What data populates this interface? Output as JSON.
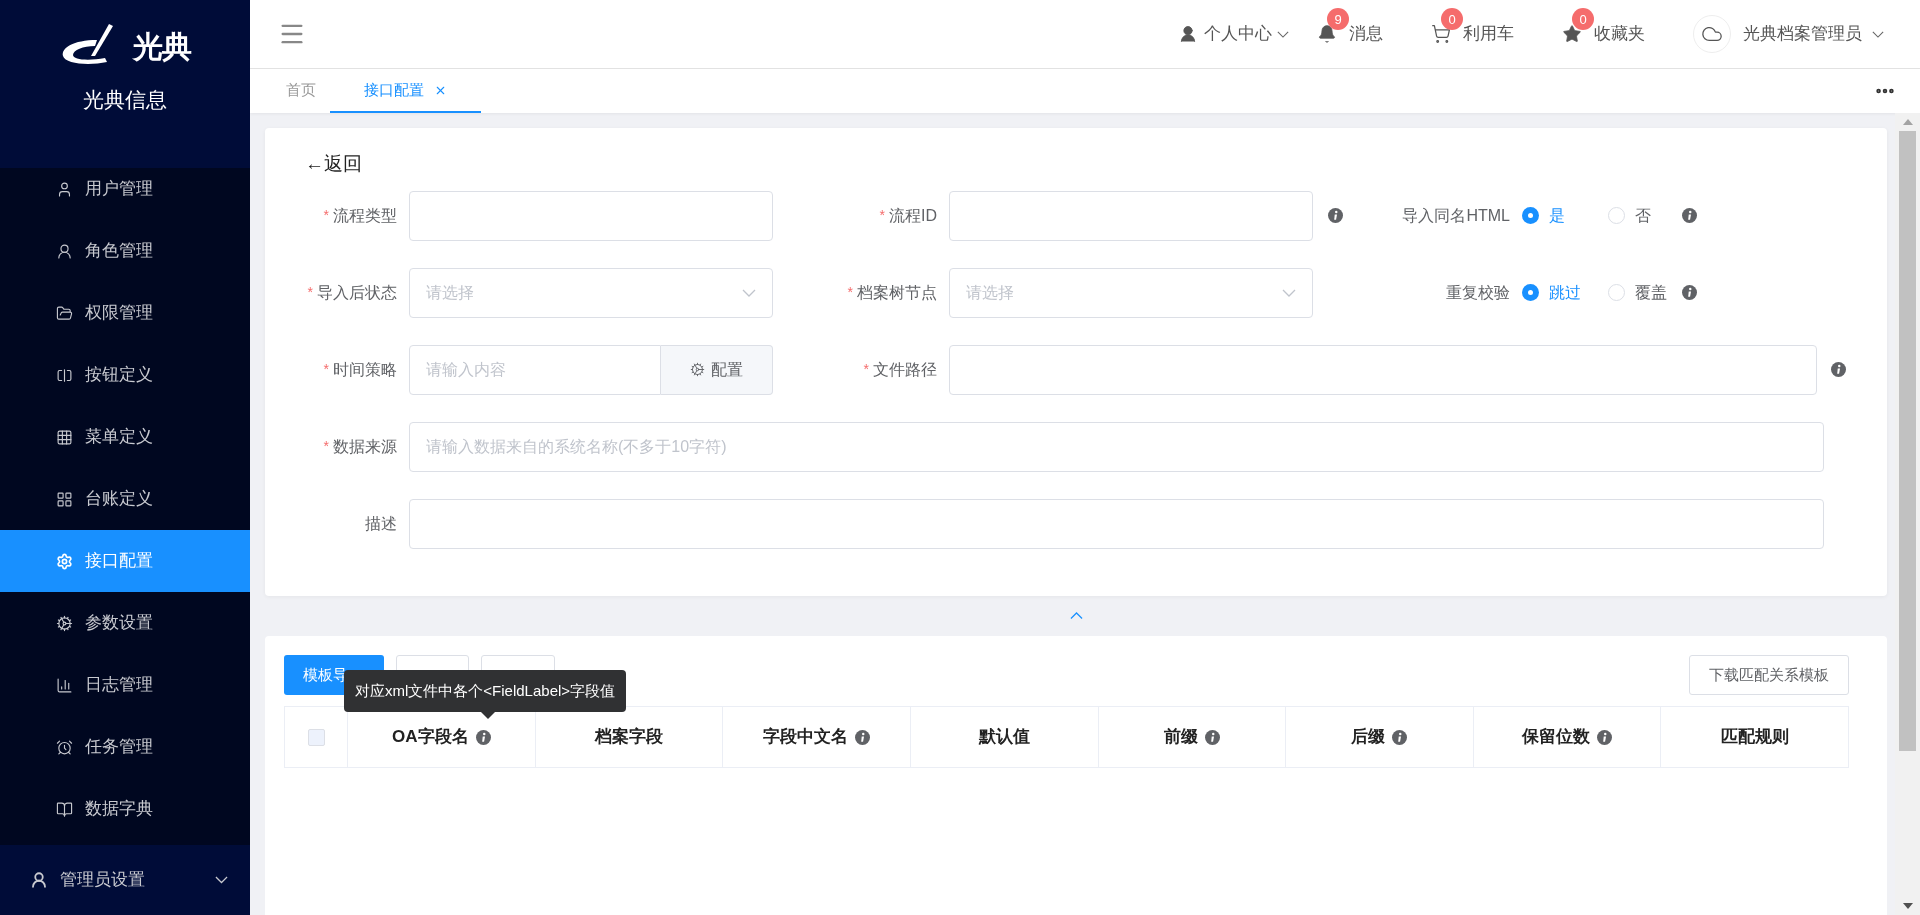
{
  "sidebar": {
    "brand": "光典",
    "title": "光典信息",
    "items": [
      {
        "label": "用户管理",
        "selected": false
      },
      {
        "label": "角色管理",
        "selected": false
      },
      {
        "label": "权限管理",
        "selected": false
      },
      {
        "label": "按钮定义",
        "selected": false
      },
      {
        "label": "菜单定义",
        "selected": false
      },
      {
        "label": "台账定义",
        "selected": false
      },
      {
        "label": "接口配置",
        "selected": true
      },
      {
        "label": "参数设置",
        "selected": false
      },
      {
        "label": "日志管理",
        "selected": false
      },
      {
        "label": "任务管理",
        "selected": false
      },
      {
        "label": "数据字典",
        "selected": false
      }
    ],
    "footer": {
      "label": "管理员设置",
      "expanded": false
    }
  },
  "header": {
    "items": [
      {
        "label": "个人中心",
        "dropdown": true
      },
      {
        "label": "消息",
        "badge": "9",
        "dropdown": false
      },
      {
        "label": "利用车",
        "badge": "0",
        "dropdown": false
      },
      {
        "label": "收藏夹",
        "badge": "0",
        "dropdown": false
      }
    ],
    "user": "光典档案管理员"
  },
  "tabs": [
    {
      "label": "首页",
      "selected": false,
      "closable": false
    },
    {
      "label": "接口配置",
      "selected": true,
      "closable": true
    }
  ],
  "back": "←返回",
  "form": {
    "rows": [
      [
        {
          "kind": "text",
          "mark": "*",
          "label": "流程类型"
        },
        {
          "kind": "text",
          "mark": "*",
          "label": "流程ID",
          "info": true
        },
        {
          "kind": "radio",
          "label": "导入同名HTML",
          "info": true,
          "options": [
            {
              "label": "是",
              "selected": true
            },
            {
              "label": "否",
              "selected": false
            }
          ]
        }
      ],
      [
        {
          "kind": "select",
          "mark": "*",
          "label": "导入后状态",
          "placeholder": "请选择"
        },
        {
          "kind": "select",
          "mark": "*",
          "label": "档案树节点",
          "placeholder": "请选择"
        },
        {
          "kind": "radio",
          "label": "重复校验",
          "info": true,
          "options": [
            {
              "label": "跳过",
              "selected": true
            },
            {
              "label": "覆盖",
              "selected": false
            }
          ]
        }
      ],
      [
        {
          "kind": "input_button",
          "mark": "*",
          "label": "时间策略",
          "placeholder": "请输入内容",
          "button": "配置"
        },
        {
          "kind": "wide",
          "mark": "*",
          "label": "文件路径",
          "info": true
        }
      ],
      [
        {
          "kind": "full",
          "mark": "*",
          "label": "数据来源",
          "placeholder": "请输入数据来自的系统名称(不多于10字符)"
        }
      ],
      [
        {
          "kind": "full",
          "label": "描述"
        }
      ]
    ]
  },
  "toolbar": {
    "buttons": [
      {
        "label": "模板导",
        "primary": true
      },
      {
        "primary": false
      },
      {
        "primary": false
      }
    ],
    "download": "下载匹配关系模板"
  },
  "tooltip": "对应xml文件中各个<FieldLabel>字段值",
  "table": {
    "select_all": {
      "checked": false
    },
    "columns": [
      {
        "label": "OA字段名",
        "info": true
      },
      {
        "label": "档案字段",
        "info": false
      },
      {
        "label": "字段中文名",
        "info": true
      },
      {
        "label": "默认值",
        "info": false
      },
      {
        "label": "前缀",
        "info": true
      },
      {
        "label": "后缀",
        "info": true
      },
      {
        "label": "保留位数",
        "info": true
      },
      {
        "label": "匹配规则",
        "info": false
      }
    ]
  }
}
